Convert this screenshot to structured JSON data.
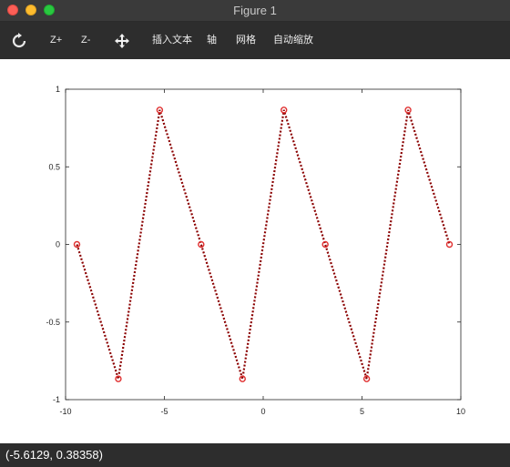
{
  "window": {
    "title": "Figure 1"
  },
  "toolbar": {
    "rotate_icon": "rotate-icon",
    "zoom_in_label": "Z+",
    "zoom_out_label": "Z-",
    "pan_icon": "pan-arrows-icon",
    "insert_text_label": "插入文本",
    "axis_label": "轴",
    "grid_label": "网格",
    "autoscale_label": "自动缩放"
  },
  "status": {
    "coordinates": "(-5.6129, 0.38358)"
  },
  "colors": {
    "line": "#8b0000",
    "marker": "#e03030",
    "toolbar_bg": "#2d2d2d",
    "titlebar_bg": "#3a3a3a"
  },
  "chart_data": {
    "type": "line",
    "title": "",
    "xlabel": "",
    "ylabel": "",
    "xlim": [
      -10,
      10
    ],
    "ylim": [
      -1,
      1
    ],
    "xticks": [
      "-10",
      "-5",
      "0",
      "5",
      "10"
    ],
    "yticks": [
      "1",
      "0.5",
      "0",
      "-0.5",
      "-1"
    ],
    "grid": false,
    "line_style": "dotted",
    "marker": "circle",
    "series": [
      {
        "x": [
          -9.4248,
          -7.3304,
          -5.236,
          -3.1416,
          -1.0472,
          1.0472,
          3.1416,
          5.236,
          7.3304,
          9.4248
        ],
        "values": [
          0,
          -0.866,
          0.866,
          0,
          -0.866,
          0.866,
          0,
          -0.866,
          0.866,
          0
        ]
      }
    ]
  }
}
